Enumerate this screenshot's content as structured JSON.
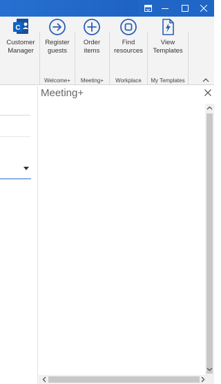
{
  "colors": {
    "titlebar": "#1f66c7",
    "accent": "#2a5fb4",
    "outlook_blue": "#0f63c2"
  },
  "titlebar": {
    "icons": [
      "ribbon-display-options-icon",
      "minimize-icon",
      "maximize-icon",
      "close-icon"
    ]
  },
  "ribbon": {
    "buttons": [
      {
        "label": "Customer\nManager",
        "icon": "customer-manager-icon"
      },
      {
        "label": "Register\nguests",
        "icon": "arrow-right-circle-icon"
      },
      {
        "label": "Order\nitems",
        "icon": "plus-circle-icon"
      },
      {
        "label": "Find\nresources",
        "icon": "circle-square-icon"
      },
      {
        "label": "View\nTemplates",
        "icon": "template-lightning-icon"
      }
    ],
    "groups": [
      "Welcome+",
      "Meeting+",
      "Workplace",
      "My Templates"
    ]
  },
  "task_pane": {
    "title": "Meeting+"
  }
}
